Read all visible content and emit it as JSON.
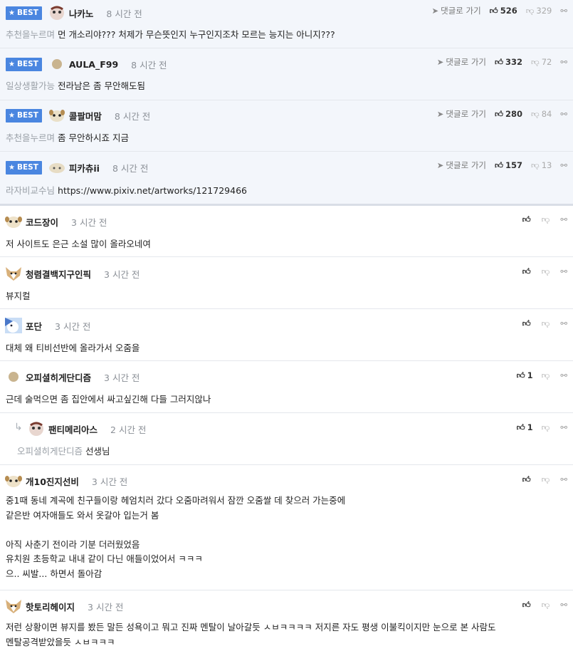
{
  "best_label": "BEST",
  "reply_to_label": "댓글로 가기",
  "best_comments": [
    {
      "nick": "나카노",
      "time": "8 시간 전",
      "mention": "추천을누르며",
      "text": "먼 개소리야??? 처제가 무슨뜻인지 누구인지조차 모르는 능지는 아니지???",
      "likes": "526",
      "dislikes": "329"
    },
    {
      "nick": "AULA_F99",
      "time": "8 시간 전",
      "mention": "일상생활가능",
      "text": "전라남은 좀 무안해도됨",
      "likes": "332",
      "dislikes": "72"
    },
    {
      "nick": "콜팔머맘",
      "time": "8 시간 전",
      "mention": "추천을누르며",
      "text": "좀 무안하시죠 지금",
      "likes": "280",
      "dislikes": "84"
    },
    {
      "nick": "피카츄ii",
      "time": "8 시간 전",
      "mention": "라자비교수님",
      "text": "https://www.pixiv.net/artworks/121729466",
      "likes": "157",
      "dislikes": "13"
    }
  ],
  "comments": [
    {
      "nick": "코드장이",
      "time": "3 시간 전",
      "text": "저 사이트도 은근 소설 많이 올라오네여",
      "likes": ""
    },
    {
      "nick": "청렴결백지구인픽",
      "time": "3 시간 전",
      "text": "뷰지컬",
      "likes": ""
    },
    {
      "nick": "포단",
      "time": "3 시간 전",
      "text": "대체 왜 티비선반에 올라가서 오줌을",
      "likes": ""
    },
    {
      "nick": "오피셜히게단디즘",
      "time": "3 시간 전",
      "text": "근데 술먹으면 좀 집안에서 싸고싶긴해 다들 그러지않나",
      "likes": "1"
    },
    {
      "nick": "팬티메리아스",
      "time": "2 시간 전",
      "mention": "오피셜히게단디즘",
      "text": "선생님",
      "likes": "1"
    },
    {
      "nick": "개10진지선비",
      "time": "3 시간 전",
      "text": "중1때 동네 계곡에 친구들이랑 헤엄치러 갔다 오줌마려워서 잠깐 오줌쌀 데 찾으러 가는중에\n같은반 여자애들도 와서 옷갈아 입는거 봄\n\n아직 사춘기 전이라 기분 더러웠었음\n유치원 초등학교 내내 같이 다닌 애들이었어서 ㅋㅋㅋ\n으.. 씨발... 하면서 돌아감",
      "likes": ""
    },
    {
      "nick": "핫토리헤이지",
      "time": "3 시간 전",
      "text": "저런 상황이면 뷰지를 봤든 말든 성욕이고 뭐고 진짜 멘탈이 날아갈듯 ㅅㅂㅋㅋㅋㅋ 저지른 자도 평생 이불킥이지만 눈으로 본 사람도\n멘탈공격받았을듯 ㅅㅂㅋㅋㅋ",
      "likes": ""
    }
  ],
  "icons": {
    "like": "thumbs-up-icon",
    "dislike": "thumbs-down-icon",
    "link": "link-icon",
    "reply": "reply-arrow-icon"
  },
  "colors": {
    "best_bg": "#f3f6fb",
    "badge": "#4a86e0"
  }
}
